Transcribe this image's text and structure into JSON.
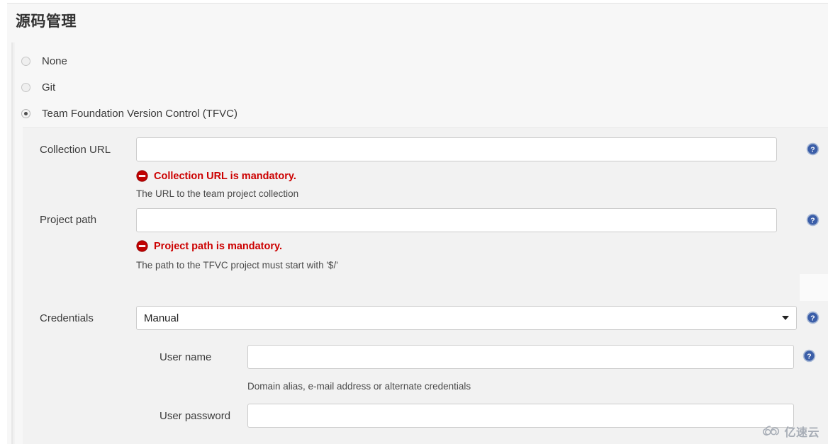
{
  "header": {
    "title": "源码管理"
  },
  "scm_options": [
    {
      "label": "None",
      "selected": false
    },
    {
      "label": "Git",
      "selected": false
    },
    {
      "label": "Team Foundation Version Control (TFVC)",
      "selected": true
    }
  ],
  "fields": {
    "collection_url": {
      "label": "Collection URL",
      "value": "",
      "error": "Collection URL is mandatory.",
      "help": "The URL to the team project collection",
      "help_icon": "help-circle-icon"
    },
    "project_path": {
      "label": "Project path",
      "value": "",
      "error": "Project path is mandatory.",
      "help": "The path to the TFVC project must start with '$/'",
      "help_icon": "help-circle-icon"
    },
    "credentials": {
      "label": "Credentials",
      "value": "Manual",
      "options": [
        "Manual"
      ],
      "help_icon": "help-circle-icon"
    },
    "user_name": {
      "label": "User name",
      "value": "",
      "help": "Domain alias, e-mail address or alternate credentials",
      "help_icon": "help-circle-icon"
    },
    "user_password": {
      "label": "User password",
      "value": "",
      "help_icon": "help-circle-icon"
    }
  },
  "watermark": {
    "text": "亿速云",
    "logo": "cloud-icon"
  },
  "colors": {
    "error": "#cc0000",
    "help_icon": "#3b5ea8",
    "page_bg": "#f7f7f7",
    "panel_bg": "#f2f2f2"
  }
}
